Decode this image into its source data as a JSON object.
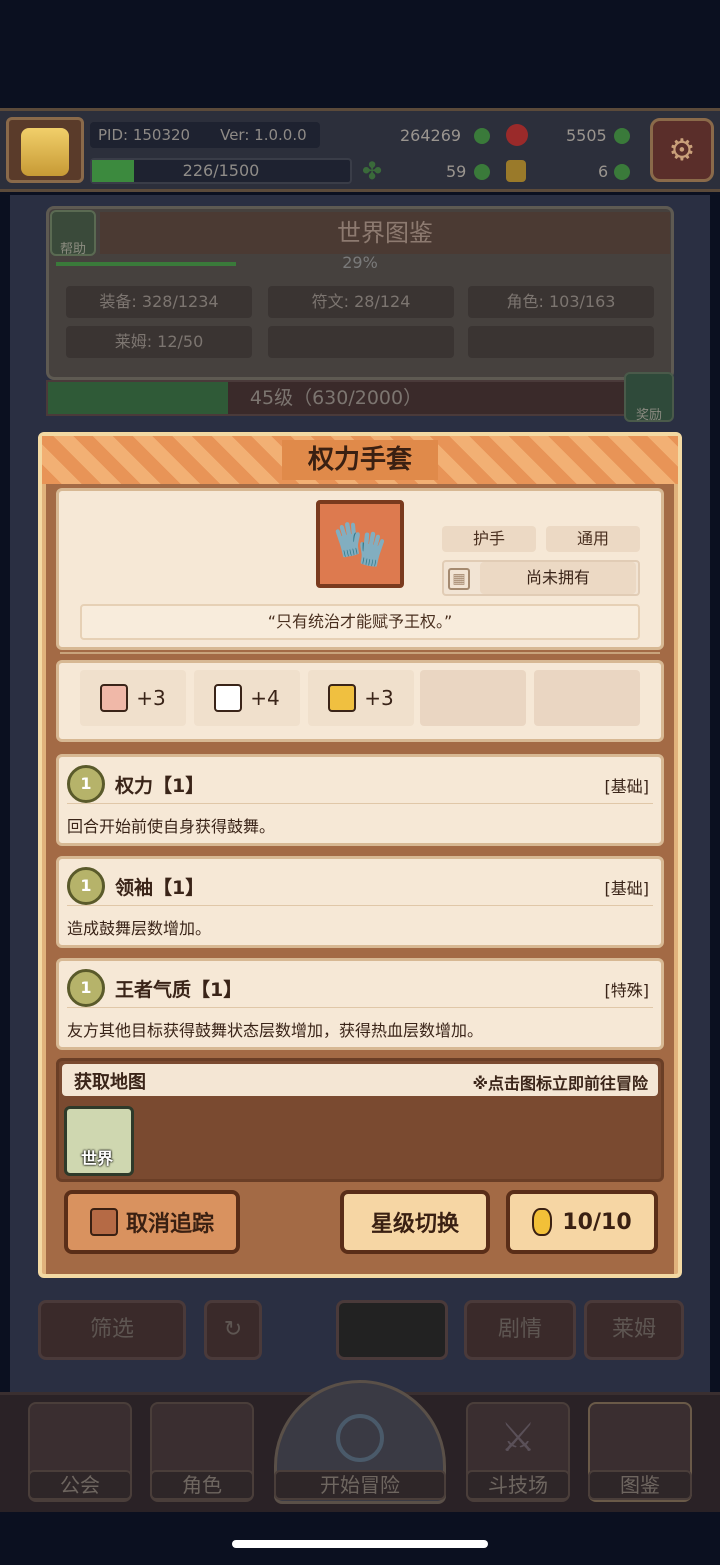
{
  "header": {
    "pid": "PID: 150320",
    "version": "Ver: 1.0.0.0",
    "gold": "264269",
    "gems": "5505",
    "stamina": "226/1500",
    "clover": "59",
    "keys": "6"
  },
  "world": {
    "title": "世界图鉴",
    "help_label": "帮助",
    "percent": "29%",
    "stats": [
      "装备: 328/1234",
      "符文: 28/124",
      "角色: 103/163",
      "莱姆: 12/50"
    ],
    "level": "45级（630/2000）",
    "reward_label": "奖励"
  },
  "modal": {
    "title": "权力手套",
    "tags": [
      "护手",
      "通用"
    ],
    "ownership": "尚未拥有",
    "quote": "“只有统治才能赋予王权。”",
    "stats": [
      "+3",
      "+4",
      "+3"
    ],
    "skills": [
      {
        "level": "1",
        "name": "权力【1】",
        "type": "[基础]",
        "desc": "回合开始前使自身获得鼓舞。"
      },
      {
        "level": "1",
        "name": "领袖【1】",
        "type": "[基础]",
        "desc": "造成鼓舞层数增加。"
      },
      {
        "level": "1",
        "name": "王者气质【1】",
        "type": "[特殊]",
        "desc": "友方其他目标获得鼓舞状态层数增加，获得热血层数增加。"
      }
    ],
    "map_title": "获取地图",
    "map_hint": "※点击图标立即前往冒险",
    "map_world": "世界",
    "btn_cancel": "取消追踪",
    "btn_star": "星级切换",
    "btn_coin": "10/10"
  },
  "bg_buttons": {
    "filter": "筛选",
    "story": "剧情",
    "lime": "莱姆"
  },
  "nav": {
    "guild": "公会",
    "character": "角色",
    "adventure": "开始冒险",
    "arena": "斗技场",
    "codex": "图鉴"
  }
}
